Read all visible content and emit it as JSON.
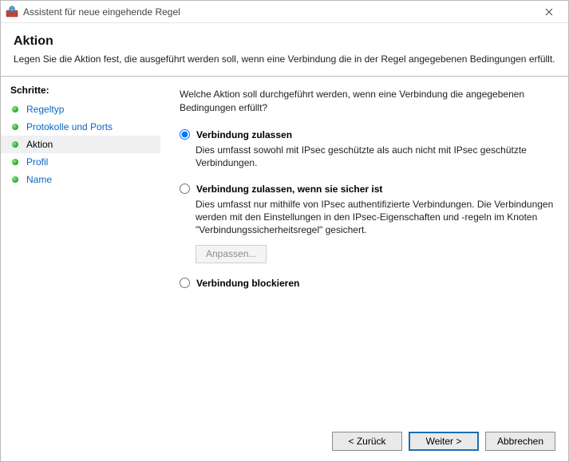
{
  "window": {
    "title": "Assistent für neue eingehende Regel"
  },
  "header": {
    "title": "Aktion",
    "subtitle": "Legen Sie die Aktion fest, die ausgeführt werden soll, wenn eine Verbindung die in der Regel angegebenen Bedingungen erfüllt."
  },
  "sidebar": {
    "steps_label": "Schritte:",
    "items": [
      {
        "label": "Regeltyp",
        "active": false
      },
      {
        "label": "Protokolle und Ports",
        "active": false
      },
      {
        "label": "Aktion",
        "active": true
      },
      {
        "label": "Profil",
        "active": false
      },
      {
        "label": "Name",
        "active": false
      }
    ]
  },
  "main": {
    "question": "Welche Aktion soll durchgeführt werden, wenn eine Verbindung die angegebenen Bedingungen erfüllt?",
    "options": [
      {
        "id": "allow",
        "title": "Verbindung zulassen",
        "desc": "Dies umfasst sowohl mit IPsec geschützte als auch nicht mit IPsec geschützte Verbindungen.",
        "selected": true
      },
      {
        "id": "allow_secure",
        "title": "Verbindung zulassen, wenn sie sicher ist",
        "desc": "Dies umfasst nur mithilfe von IPsec authentifizierte Verbindungen. Die Verbindungen werden mit den Einstellungen in den IPsec-Eigenschaften und -regeln im Knoten \"Verbindungssicherheitsregel\" gesichert.",
        "selected": false
      },
      {
        "id": "block",
        "title": "Verbindung blockieren",
        "desc": "",
        "selected": false
      }
    ],
    "customize_label": "Anpassen..."
  },
  "footer": {
    "back": "< Zurück",
    "next": "Weiter >",
    "cancel": "Abbrechen"
  }
}
